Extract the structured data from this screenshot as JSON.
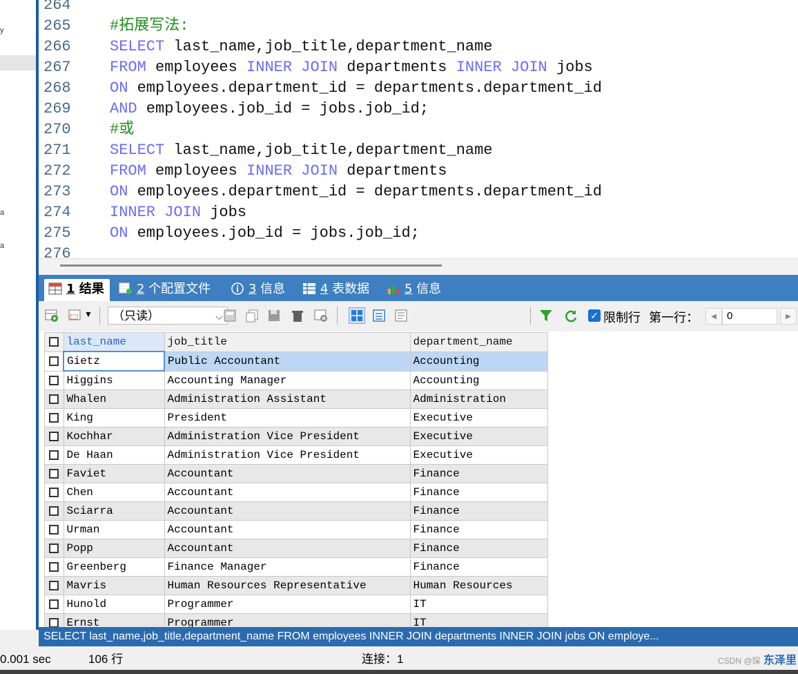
{
  "left_fragments": [
    "y",
    "a",
    "a"
  ],
  "editor": {
    "lines": [
      {
        "n": "264",
        "segs": []
      },
      {
        "n": "265",
        "segs": [
          {
            "t": "#拓展写法:",
            "k": "cm"
          }
        ]
      },
      {
        "n": "266",
        "segs": [
          {
            "t": "SELECT",
            "k": "kw"
          },
          {
            "t": " last_name,job_title,department_name",
            "k": ""
          }
        ]
      },
      {
        "n": "267",
        "segs": [
          {
            "t": "FROM",
            "k": "kw"
          },
          {
            "t": " employees ",
            "k": ""
          },
          {
            "t": "INNER JOIN",
            "k": "kw"
          },
          {
            "t": " departments ",
            "k": ""
          },
          {
            "t": "INNER JOIN",
            "k": "kw"
          },
          {
            "t": " jobs",
            "k": ""
          }
        ]
      },
      {
        "n": "268",
        "segs": [
          {
            "t": "ON",
            "k": "kw"
          },
          {
            "t": " employees.department_id = departments.department_id",
            "k": ""
          }
        ]
      },
      {
        "n": "269",
        "segs": [
          {
            "t": "AND",
            "k": "kw"
          },
          {
            "t": " employees.job_id = jobs.job_id;",
            "k": ""
          }
        ]
      },
      {
        "n": "270",
        "segs": [
          {
            "t": "#或",
            "k": "cm"
          }
        ]
      },
      {
        "n": "271",
        "segs": [
          {
            "t": "SELECT",
            "k": "kw"
          },
          {
            "t": " last_name,job_title,department_name",
            "k": ""
          }
        ]
      },
      {
        "n": "272",
        "segs": [
          {
            "t": "FROM",
            "k": "kw"
          },
          {
            "t": " employees ",
            "k": ""
          },
          {
            "t": "INNER JOIN",
            "k": "kw"
          },
          {
            "t": " departments",
            "k": ""
          }
        ]
      },
      {
        "n": "273",
        "segs": [
          {
            "t": "ON",
            "k": "kw"
          },
          {
            "t": " employees.department_id = departments.department_id",
            "k": ""
          }
        ]
      },
      {
        "n": "274",
        "segs": [
          {
            "t": "INNER JOIN",
            "k": "kw"
          },
          {
            "t": " jobs",
            "k": ""
          }
        ]
      },
      {
        "n": "275",
        "segs": [
          {
            "t": "ON",
            "k": "kw"
          },
          {
            "t": " employees.job_id = jobs.job_id;",
            "k": ""
          }
        ]
      },
      {
        "n": "276",
        "segs": []
      }
    ]
  },
  "tabs": [
    {
      "num": "1",
      "label": " 结果",
      "icon": "grid-icon",
      "active": true
    },
    {
      "num": "2",
      "label": " 个配置文件",
      "icon": "profile-icon",
      "active": false
    },
    {
      "num": "3",
      "label": " 信息",
      "icon": "info-icon",
      "active": false
    },
    {
      "num": "4",
      "label": " 表数据",
      "icon": "table-data-icon",
      "active": false
    },
    {
      "num": "5",
      "label": " 信息",
      "icon": "chart-info-icon",
      "active": false
    }
  ],
  "toolbar": {
    "readonly_option": "（只读）",
    "limit_rows_label": "限制行",
    "first_row_label": "第一行：",
    "first_row_value": "0"
  },
  "grid": {
    "columns": [
      "last_name",
      "job_title",
      "department_name"
    ],
    "rows": [
      [
        "Gietz",
        "Public Accountant",
        "Accounting"
      ],
      [
        "Higgins",
        "Accounting Manager",
        "Accounting"
      ],
      [
        "Whalen",
        "Administration Assistant",
        "Administration"
      ],
      [
        "King",
        "President",
        "Executive"
      ],
      [
        "Kochhar",
        "Administration Vice President",
        "Executive"
      ],
      [
        "De Haan",
        "Administration Vice President",
        "Executive"
      ],
      [
        "Faviet",
        "Accountant",
        "Finance"
      ],
      [
        "Chen",
        "Accountant",
        "Finance"
      ],
      [
        "Sciarra",
        "Accountant",
        "Finance"
      ],
      [
        "Urman",
        "Accountant",
        "Finance"
      ],
      [
        "Popp",
        "Accountant",
        "Finance"
      ],
      [
        "Greenberg",
        "Finance Manager",
        "Finance"
      ],
      [
        "Mavris",
        "Human Resources Representative",
        "Human Resources"
      ],
      [
        "Hunold",
        "Programmer",
        "IT"
      ],
      [
        "Ernst",
        "Programmer",
        "IT"
      ]
    ]
  },
  "status": {
    "sql": "SELECT last_name,job_title,department_name FROM employees INNER JOIN departments INNER JOIN jobs ON employe...",
    "time": "0.001 sec",
    "rows": "106 行",
    "connection": "连接：1",
    "watermark": "CSDN @琛",
    "watermark_overlay": "东泽里"
  },
  "colors": {
    "keyword": "#6b6bff",
    "comment": "#1f8f1f",
    "tabbar": "#3d7fc0",
    "statusbar": "#2a6bb0"
  }
}
